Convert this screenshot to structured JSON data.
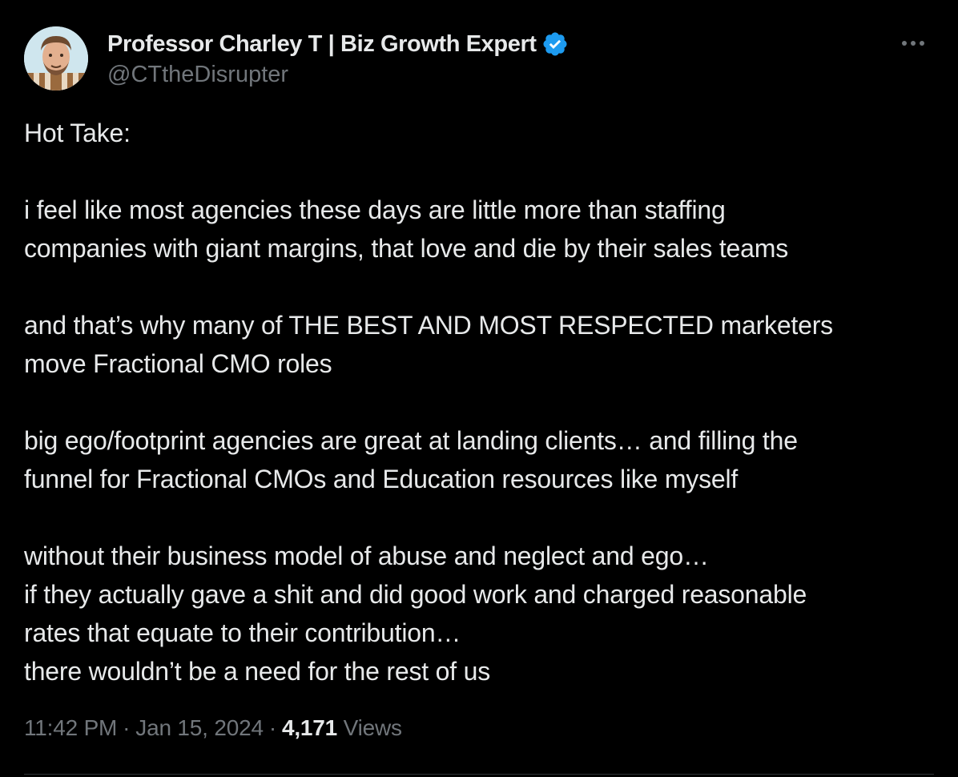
{
  "author": {
    "display_name": "Professor Charley T | Biz Growth Expert",
    "handle": "@CTtheDisrupter",
    "avatar_icon": "profile-photo",
    "verified_icon": "verified-badge-icon",
    "verified_color": "#1d9bf0"
  },
  "more_icon": "more-options-icon",
  "tweet": {
    "lines": [
      "Hot Take:",
      "",
      "i feel like most agencies these days are little more than staffing",
      "companies with giant margins, that love and die by their sales teams",
      "",
      "and that’s why many of THE BEST AND MOST RESPECTED marketers",
      "move Fractional CMO roles",
      "",
      "big ego/footprint agencies are great at landing clients… and filling the",
      "funnel for Fractional CMOs and Education resources like myself",
      "",
      "without their business model of abuse and neglect and ego…",
      "if they actually gave a shit and did good work and charged reasonable",
      "rates that equate to their contribution…",
      "there wouldn’t be a need for the rest of us"
    ]
  },
  "meta": {
    "time": "11:42 PM",
    "separator": "·",
    "date": "Jan 15, 2024",
    "views_count": "4,171",
    "views_label": "Views"
  },
  "colors": {
    "background": "#000000",
    "text_primary": "#e7e9ea",
    "text_secondary": "#71767b",
    "divider": "#2f3336"
  }
}
